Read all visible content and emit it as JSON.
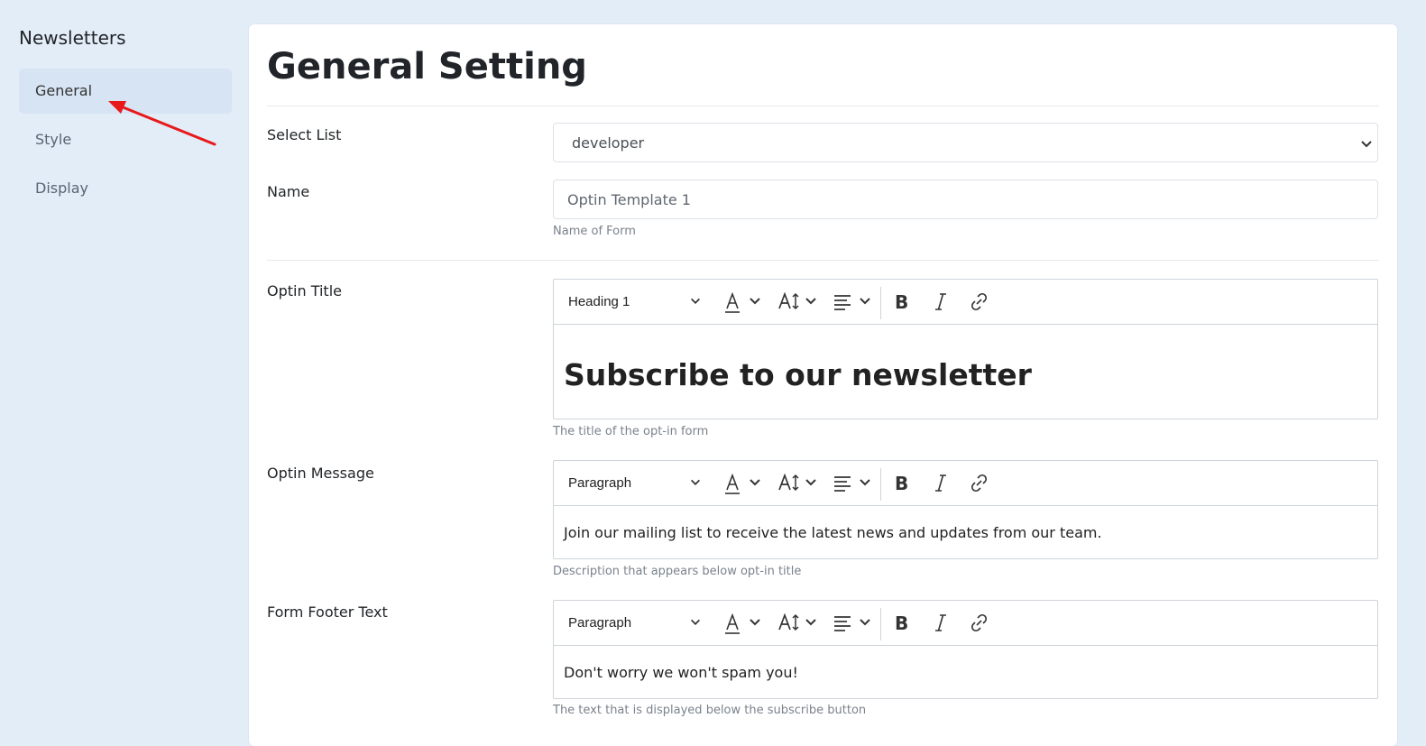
{
  "sidebar": {
    "title": "Newsletters",
    "items": [
      {
        "label": "General",
        "active": true
      },
      {
        "label": "Style",
        "active": false
      },
      {
        "label": "Display",
        "active": false
      }
    ]
  },
  "page": {
    "title": "General Setting"
  },
  "form": {
    "select_list": {
      "label": "Select List",
      "value": "developer"
    },
    "name": {
      "label": "Name",
      "value": "Optin Template 1",
      "help": "Name of Form"
    },
    "optin_title": {
      "label": "Optin Title",
      "format": "Heading 1",
      "content": "Subscribe to our newsletter",
      "help": "The title of the opt-in form"
    },
    "optin_message": {
      "label": "Optin Message",
      "format": "Paragraph",
      "content": "Join our mailing list to receive the latest news and updates from our team.",
      "help": "Description that appears below opt-in title"
    },
    "footer_text": {
      "label": "Form Footer Text",
      "format": "Paragraph",
      "content": "Don't worry we won't spam you!",
      "help": "The text that is displayed below the subscribe button"
    }
  },
  "colors": {
    "background": "#e3edf8",
    "active_nav": "#d7e4f3",
    "annotation_arrow": "#e8191b"
  },
  "icons": [
    "chevron-down-icon",
    "font-color-icon",
    "font-size-icon",
    "align-icon",
    "bold-icon",
    "italic-icon",
    "link-icon",
    "annotation-arrow"
  ]
}
